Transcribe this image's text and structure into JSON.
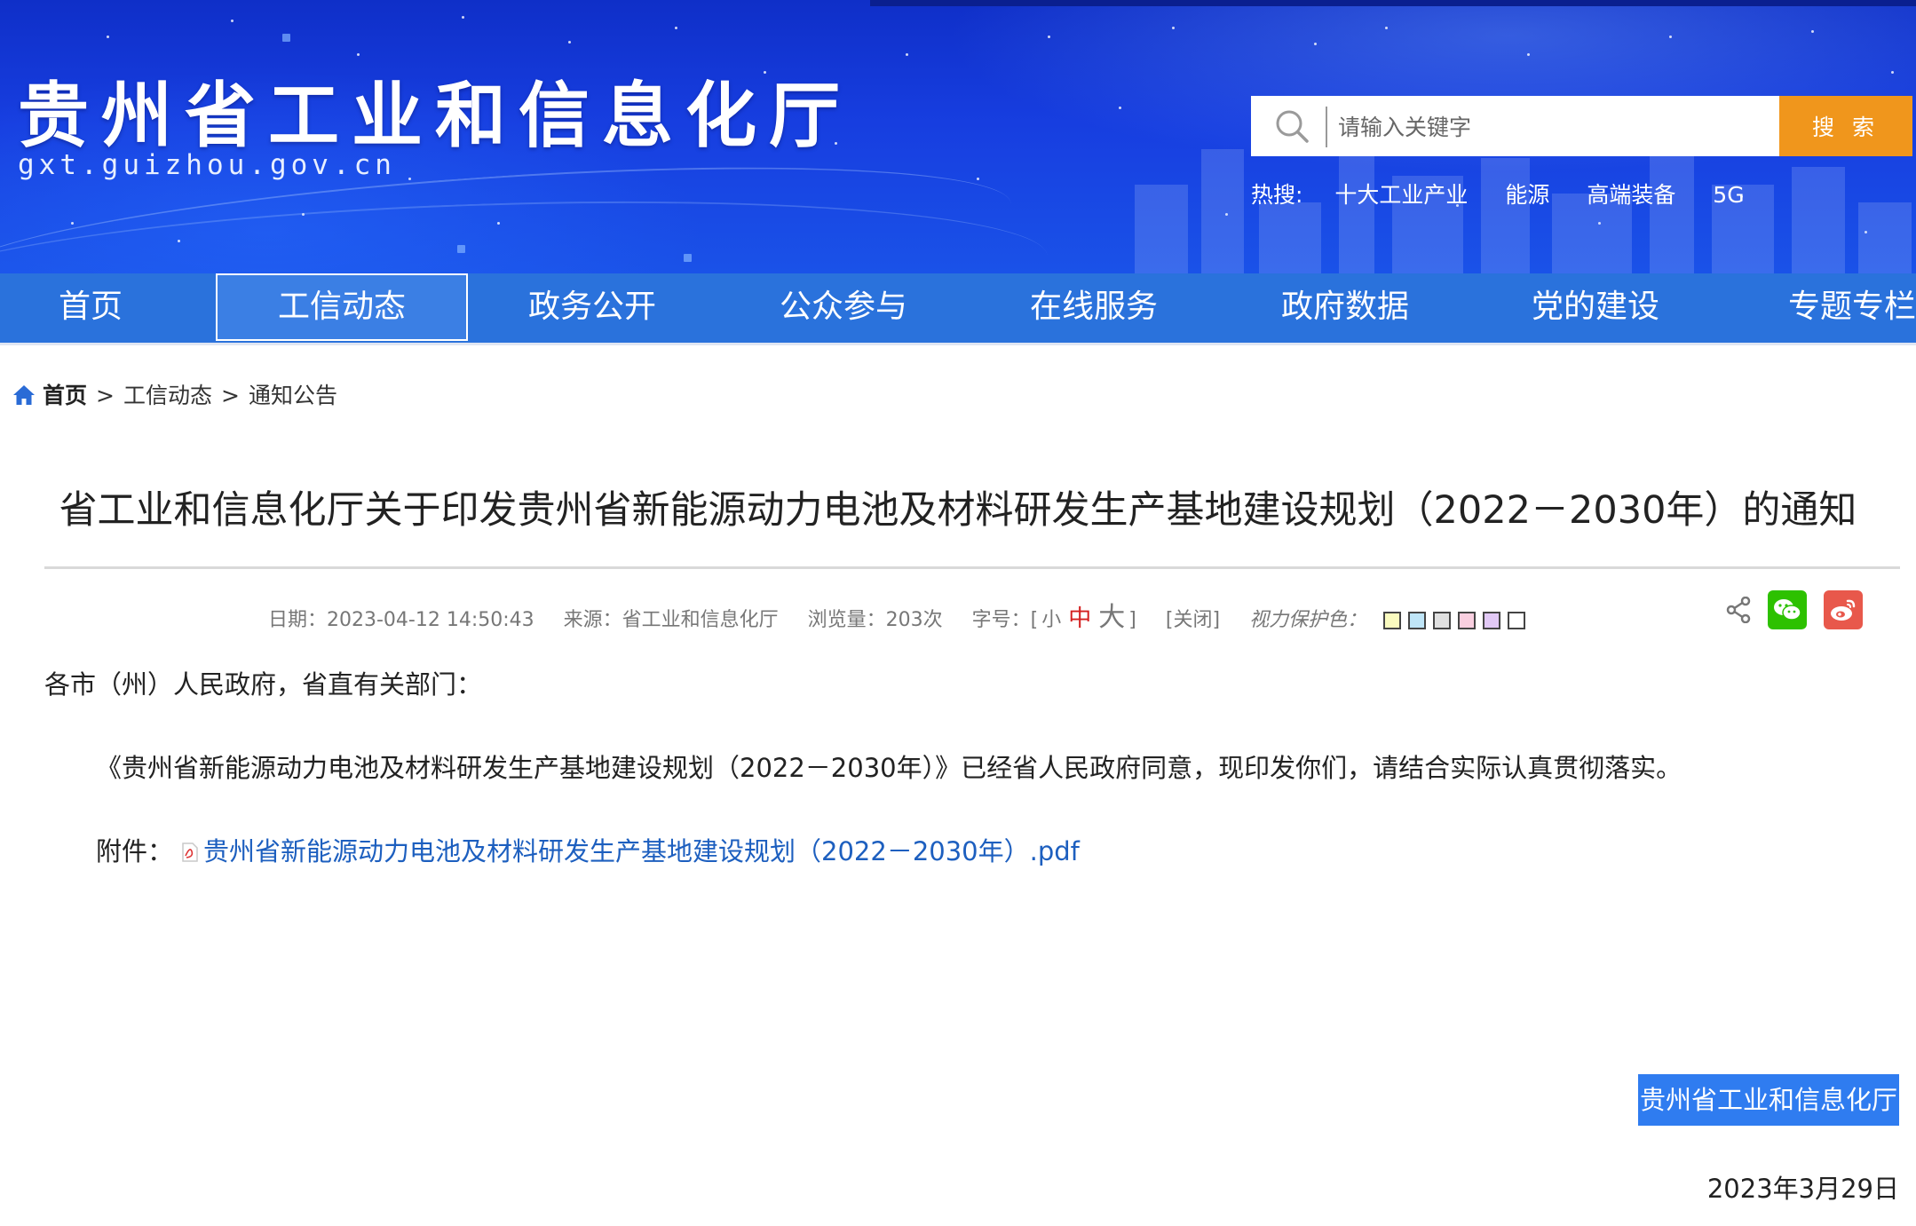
{
  "header": {
    "site_title": "贵州省工业和信息化厅",
    "site_domain": "gxt.guizhou.gov.cn",
    "search": {
      "placeholder": "请输入关键字",
      "button_label": "搜 索",
      "icon": "search-icon"
    },
    "hot": {
      "label": "热搜:",
      "terms": [
        "十大工业产业",
        "能源",
        "高端装备",
        "5G"
      ]
    }
  },
  "nav": {
    "items": [
      {
        "label": "首页"
      },
      {
        "label": "工信动态",
        "active": true
      },
      {
        "label": "政务公开"
      },
      {
        "label": "公众参与"
      },
      {
        "label": "在线服务"
      },
      {
        "label": "政府数据"
      },
      {
        "label": "党的建设"
      },
      {
        "label": "专题专栏"
      }
    ],
    "color": "#2a72dc"
  },
  "breadcrumb": {
    "home": "首页",
    "sep": ">",
    "items": [
      "工信动态",
      "通知公告"
    ]
  },
  "article": {
    "title": "省工业和信息化厅关于印发贵州省新能源动力电池及材料研发生产基地建设规划（2022－2030年）的通知",
    "meta": {
      "date": "日期：2023-04-12 14:50:43",
      "source": "来源：省工业和信息化厅",
      "views": "浏览量：203次",
      "font_size_label": "字号：[",
      "font_small": "小",
      "font_mid": "中",
      "font_big": "大",
      "font_close": "]",
      "close": "[关闭]",
      "eye_care_label": "视力保护色：",
      "eye_care_colors": [
        "#fafbbf",
        "#bfe5f7",
        "#e0e0e0",
        "#f9cfe0",
        "#e2c9f6",
        "#ffffff"
      ]
    },
    "salutation": "各市（州）人民政府，省直有关部门：",
    "paragraph": "《贵州省新能源动力电池及材料研发生产基地建设规划（2022－2030年）》已经省人民政府同意，现印发你们，请结合实际认真贯彻落实。",
    "attachment_label": "附件：",
    "attachment_name": "贵州省新能源动力电池及材料研发生产基地建设规划（2022－2030年）.pdf",
    "signature": "贵州省工业和信息化厅",
    "sign_date": "2023年3月29日"
  },
  "colors": {
    "accent_orange": "#f0961c",
    "link_blue": "#1d5fbf",
    "highlight_blue": "#2f7cf0",
    "font_mid_red": "#d42020"
  }
}
